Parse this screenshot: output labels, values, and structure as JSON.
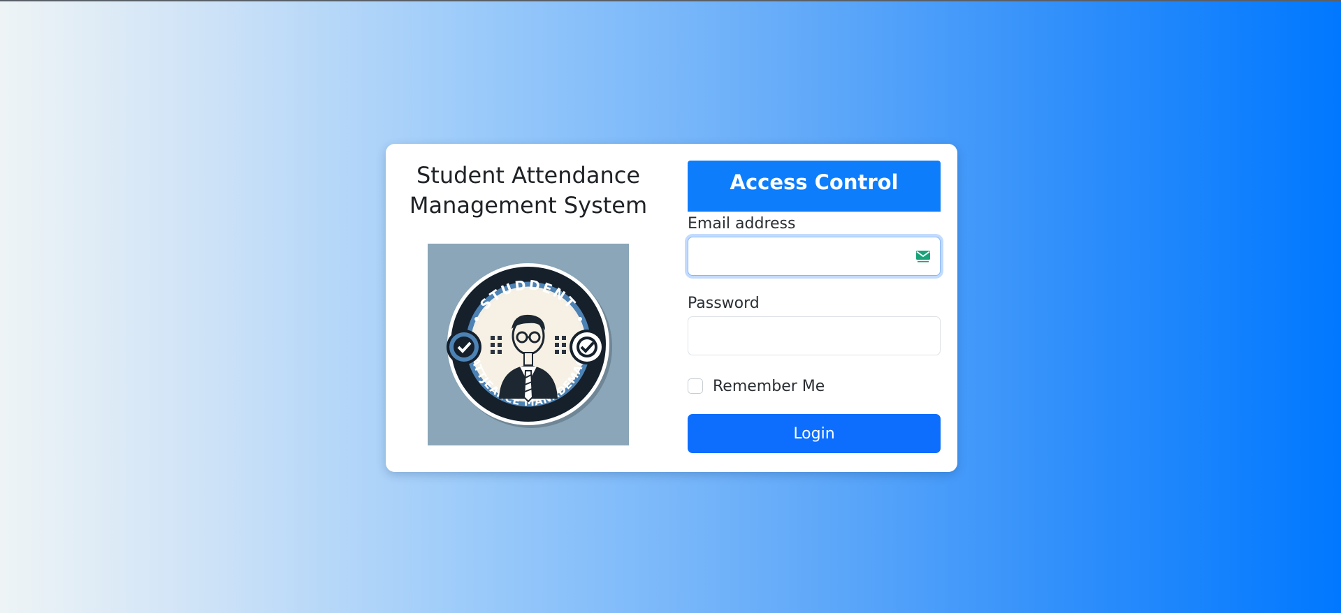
{
  "page": {
    "system_title": "Student Attendance Management System"
  },
  "logo": {
    "top_text": "STUDDENT",
    "bottom_text": "ATTJEANCE MANADEMAC",
    "icon": "student-badge-logo"
  },
  "form": {
    "header": "Access Control",
    "email_label": "Email address",
    "email_value": "",
    "email_icon": "mail-icon",
    "password_label": "Password",
    "password_value": "",
    "remember_label": "Remember Me",
    "remember_checked": false,
    "login_label": "Login"
  },
  "colors": {
    "primary": "#0d6efd",
    "header": "#0d7dfb",
    "card": "#ffffff",
    "gradient_start": "#eef4f6",
    "gradient_end": "#0078ff"
  }
}
